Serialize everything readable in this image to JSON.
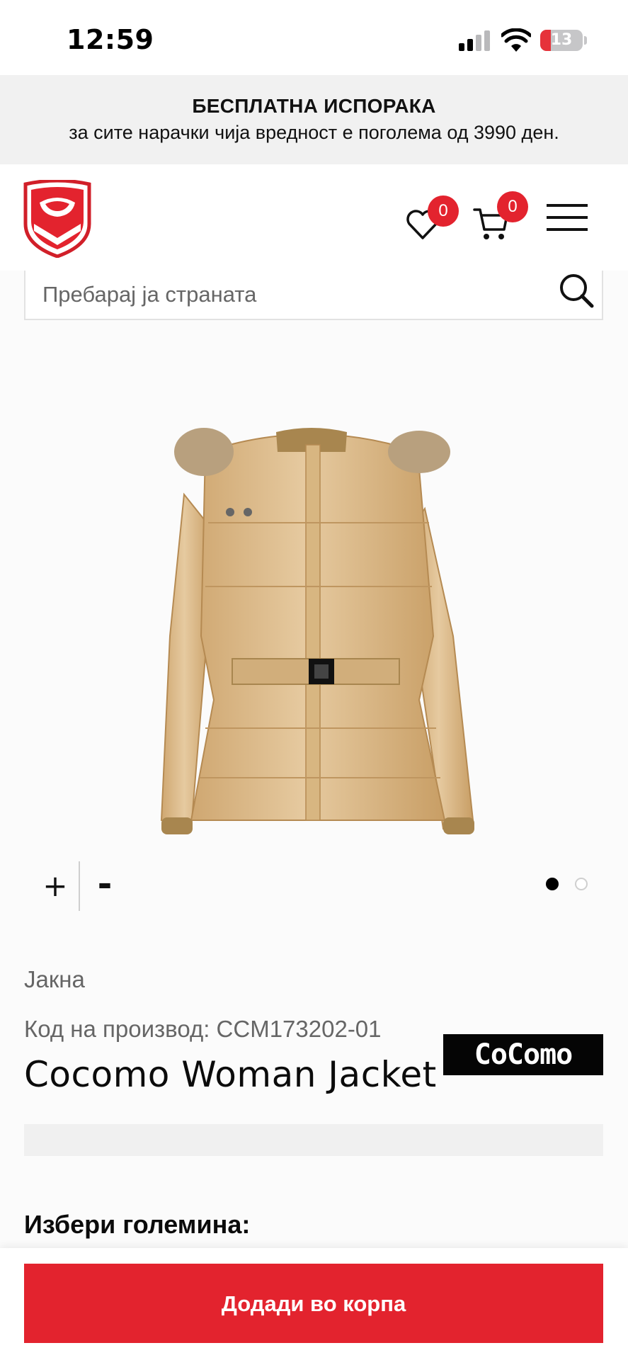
{
  "status_bar": {
    "time": "12:59",
    "battery": "13",
    "battery_level": 0.13
  },
  "promo": {
    "title": "БЕСПЛАТНА ИСПОРАКА",
    "subtitle": "за сите нарачки чија вредност е поголема од 3990 ден."
  },
  "header": {
    "logo_icon": "shield-logo-icon",
    "wishlist_icon": "heart-icon",
    "wishlist_count": "0",
    "cart_icon": "cart-icon",
    "cart_count": "0",
    "menu_icon": "hamburger-menu-icon"
  },
  "search": {
    "placeholder": "Пребарај ја страната",
    "icon": "search-icon"
  },
  "gallery": {
    "zoom_in": "+",
    "zoom_out": "-",
    "pages_total": 2,
    "active_page": 1
  },
  "product": {
    "category": "Јакна",
    "code_label": "Код на производ:",
    "code": "CCM173202-01",
    "title": "Cocomo Woman Jacket",
    "brand_logo_text": "CoComo"
  },
  "size": {
    "label": "Избери големина:"
  },
  "cart_button": {
    "label": "Додади во корпа"
  },
  "colors": {
    "accent": "#e3232e",
    "promo_bg": "#f1f1f1",
    "jacket": "#d9b889"
  }
}
